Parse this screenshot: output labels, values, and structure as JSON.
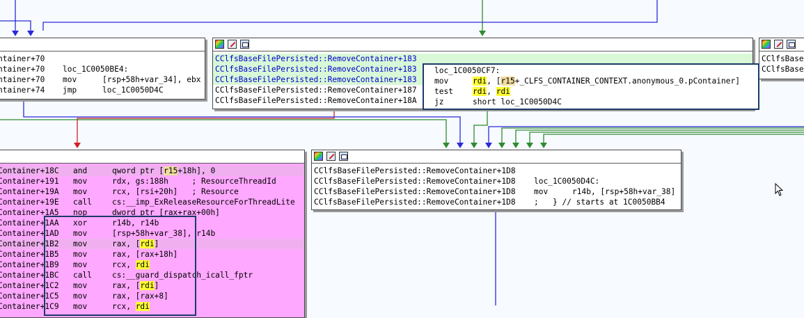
{
  "colors": {
    "node_bg": "#ffffff",
    "pink_bg": "#ffa8ff",
    "green_row": "#d8f8d8",
    "reg_highlight": "#ffff33",
    "edge_green": "#2e8b2e",
    "edge_blue": "#2b2bd6",
    "edge_red": "#d02020",
    "selection": "#1b3a68",
    "func_link": "#0000cc"
  },
  "toolbar_icons": [
    "color-palette-icon",
    "edit-node-icon",
    "graph-view-icon"
  ],
  "node_left": {
    "rows": [
      {
        "a": "ntainer+70",
        "m": "",
        "o": ""
      },
      {
        "a": "ntainer+70",
        "m": "loc_1C0050BE4:",
        "o": ""
      },
      {
        "a": "ntainer+70",
        "m": "mov",
        "o": "[rsp+58h+var_34], ebx"
      },
      {
        "a": "ntainer+74",
        "m": "jmp",
        "o": "loc_1C0050D4C"
      }
    ]
  },
  "node_top": {
    "addresses": [
      "CClfsBaseFilePersisted::RemoveContainer+183",
      "CClfsBaseFilePersisted::RemoveContainer+183",
      "CClfsBaseFilePersisted::RemoveContainer+183",
      "CClfsBaseFilePersisted::RemoveContainer+187",
      "CClfsBaseFilePersisted::RemoveContainer+18A"
    ],
    "label": "loc_1C0050CF7:",
    "rows": [
      {
        "m": "mov",
        "r1": "rdi",
        "sep": ", [",
        "r2": "r15",
        "rest": "+_CLFS_CONTAINER_CONTEXT.anonymous_0.pContainer]"
      },
      {
        "m": "test",
        "r1": "rdi",
        "sep": ", ",
        "r2": "rdi",
        "rest": ""
      },
      {
        "m": "jz",
        "r1": "",
        "sep": "",
        "r2": "",
        "rest": "short loc_1C0050D4C"
      }
    ]
  },
  "node_right": {
    "lines": [
      "CClfsBase",
      "CClfsBase"
    ]
  },
  "node_pink": {
    "rows": [
      {
        "a": "Container+18C",
        "m": "and",
        "o": "qword ptr [r15+18h], 0"
      },
      {
        "a": "Container+191",
        "m": "mov",
        "o": "rdx, gs:188h     ; ResourceThreadId"
      },
      {
        "a": "Container+19A",
        "m": "mov",
        "o": "rcx, [rsi+20h]   ; Resource"
      },
      {
        "a": "Container+19E",
        "m": "call",
        "o": "cs:__imp_ExReleaseResourceForThreadLite"
      },
      {
        "a": "Container+1A5",
        "m": "nop",
        "o": "dword ptr [rax+rax+00h]"
      },
      {
        "a": "Container+1AA",
        "m": "xor",
        "o": "r14b, r14b"
      },
      {
        "a": "Container+1AD",
        "m": "mov",
        "o": "[rsp+58h+var_38], r14b"
      },
      {
        "a": "Container+1B2",
        "m": "mov",
        "o": "rax, [rdi]"
      },
      {
        "a": "Container+1B5",
        "m": "mov",
        "o": "rax, [rax+18h]"
      },
      {
        "a": "Container+1B9",
        "m": "mov",
        "o": "rcx, rdi"
      },
      {
        "a": "Container+1BC",
        "m": "call",
        "o": "cs:__guard_dispatch_icall_fptr"
      },
      {
        "a": "Container+1C2",
        "m": "mov",
        "o": "rax, [rdi]"
      },
      {
        "a": "Container+1C5",
        "m": "mov",
        "o": "rax, [rax+8]"
      },
      {
        "a": "Container+1C9",
        "m": "mov",
        "o": "rcx, rdi"
      }
    ]
  },
  "node_mid": {
    "rows": [
      {
        "a": "CClfsBaseFilePersisted::RemoveContainer+1D8",
        "m": "",
        "o": ""
      },
      {
        "a": "CClfsBaseFilePersisted::RemoveContainer+1D8",
        "m": "loc_1C0050D4C:",
        "o": ""
      },
      {
        "a": "CClfsBaseFilePersisted::RemoveContainer+1D8",
        "m": "mov",
        "o": "r14b, [rsp+58h+var_38]"
      },
      {
        "a": "CClfsBaseFilePersisted::RemoveContainer+1D8",
        "m": ";",
        "o": "} // starts at 1C0050BB4"
      }
    ]
  }
}
